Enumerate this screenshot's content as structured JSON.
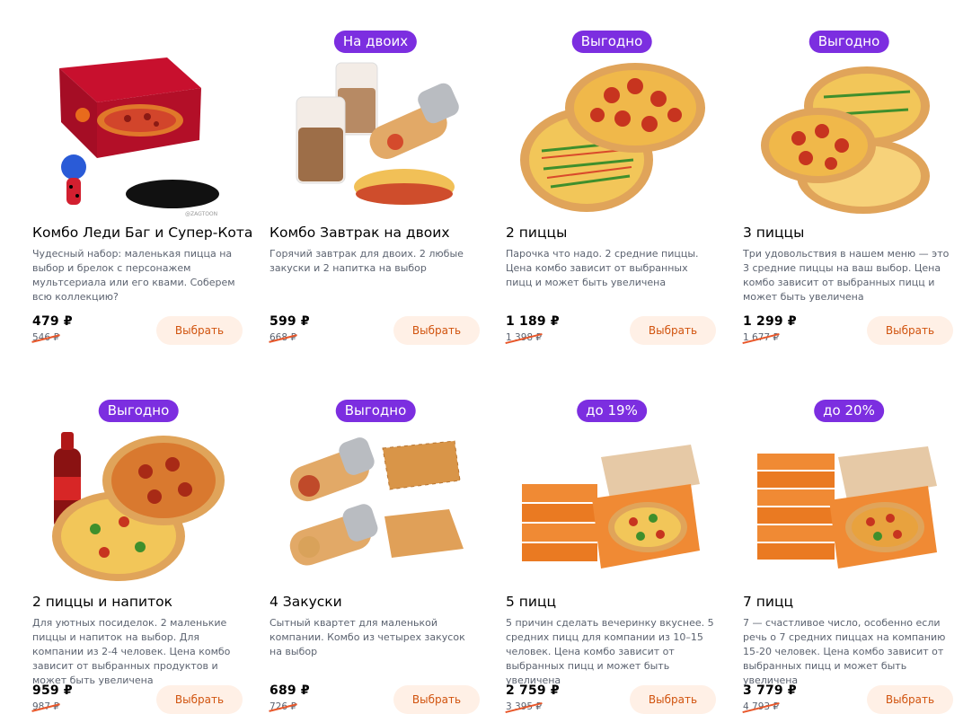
{
  "products": [
    {
      "title": "Комбо Леди Баг и Супер-Кота",
      "badge": "",
      "desc": "Чудесный набор: маленькая пицца на выбор и брелок с персонажем мультсериала или его квами. Соберем всю коллекцию?",
      "price": "479 ₽",
      "old_price": "546 ₽",
      "button": "Выбрать",
      "image_caption": "@ZAGTOON"
    },
    {
      "title": "Комбо Завтрак на двоих",
      "badge": "На двоих",
      "desc": "Горячий завтрак для двоих. 2 любые закуски и 2 напитка на выбор",
      "price": "599 ₽",
      "old_price": "668 ₽",
      "button": "Выбрать"
    },
    {
      "title": "2 пиццы",
      "badge": "Выгодно",
      "desc": "Парочка что надо. 2 средние пиццы. Цена комбо зависит от выбранных пицц и может быть увеличена",
      "price": "1 189 ₽",
      "old_price": "1 398 ₽",
      "button": "Выбрать"
    },
    {
      "title": "3 пиццы",
      "badge": "Выгодно",
      "desc": "Три удовольствия в нашем меню — это 3 средние пиццы на ваш выбор. Цена комбо зависит от выбранных пицц и может быть увеличена",
      "price": "1 299 ₽",
      "old_price": "1 677 ₽",
      "button": "Выбрать"
    },
    {
      "title": "2 пиццы и напиток",
      "badge": "Выгодно",
      "desc": "Для уютных посиделок. 2 маленькие пиццы и напиток на выбор. Для компании из 2-4 человек. Цена комбо зависит от выбранных продуктов и может быть увеличена",
      "price": "959 ₽",
      "old_price": "987 ₽",
      "button": "Выбрать"
    },
    {
      "title": "4 Закуски",
      "badge": "Выгодно",
      "desc": "Сытный квартет для маленькой компании. Комбо из четырех закусок на выбор",
      "price": "689 ₽",
      "old_price": "726 ₽",
      "button": "Выбрать"
    },
    {
      "title": "5 пицц",
      "badge": "до 19%",
      "desc": "5 причин сделать вечеринку вкуснее. 5 средних пицц для компании из 10–15 человек. Цена комбо зависит от выбранных пицц и может быть увеличена",
      "price": "2 759 ₽",
      "old_price": "3 395 ₽",
      "button": "Выбрать"
    },
    {
      "title": "7 пицц",
      "badge": "до 20%",
      "desc": "7 — счастливое число, особенно если речь о 7 средних пиццах на компанию 15-20 человек. Цена комбо зависит от выбранных пицц и может быть увеличена",
      "price": "3 779 ₽",
      "old_price": "4 793 ₽",
      "button": "Выбрать"
    }
  ],
  "colors": {
    "badge": "#7c2ee0",
    "button_bg": "#fff0e6",
    "button_text": "#d1530e",
    "strike": "#e8572a"
  }
}
